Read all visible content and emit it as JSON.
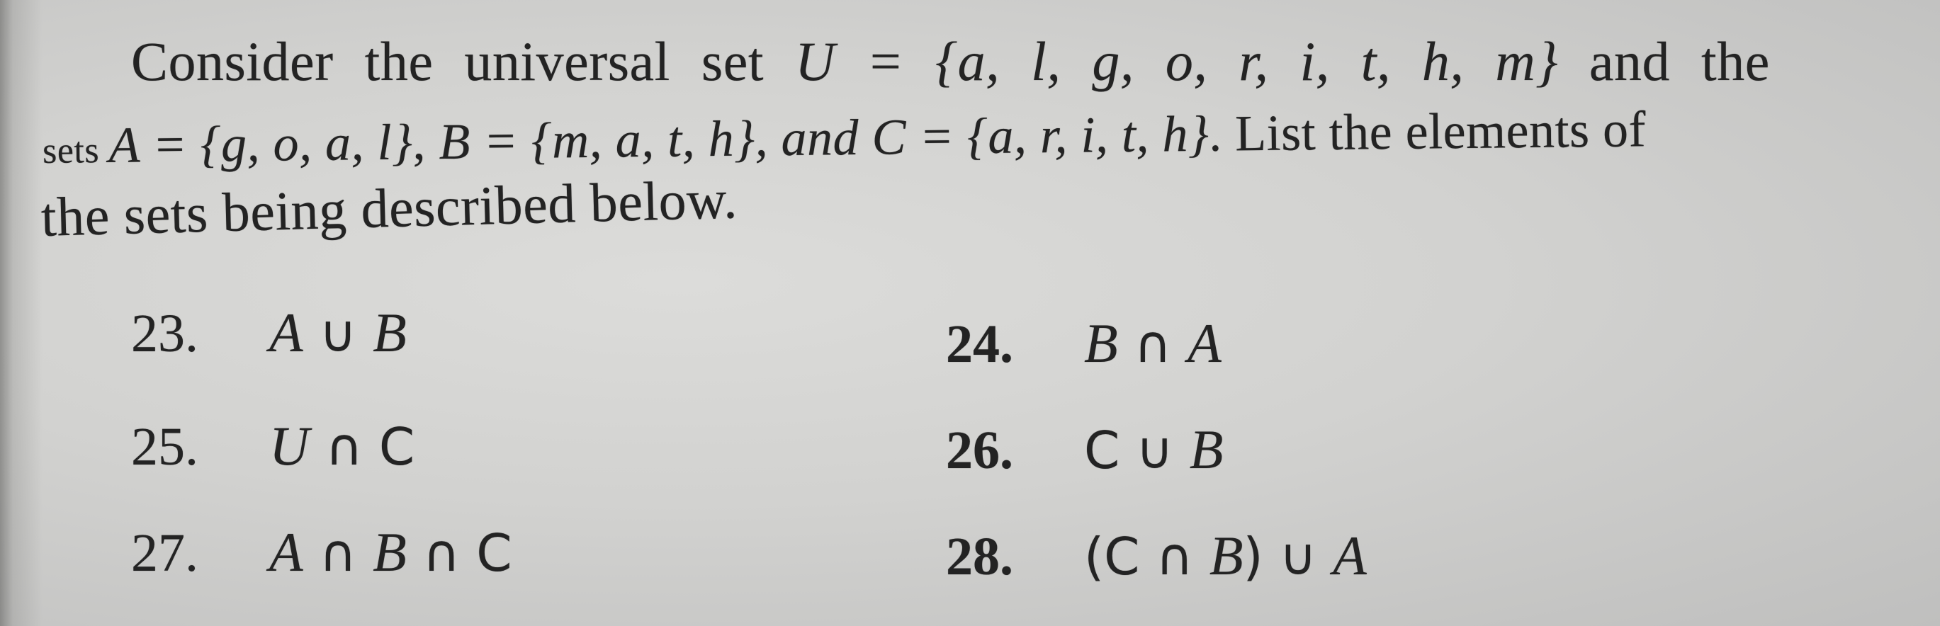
{
  "problem": {
    "intro": {
      "line1_text": "Consider the universal set ",
      "universal_set_name": "U",
      "universal_set_value": " = {a, l, g, o, r, i, t, h, m}",
      "line1_tail": " and the",
      "line2_prefix": "sets ",
      "set_A": "A = {g, o, a, l}",
      "sep1": ", ",
      "set_B": "B = {m, a, t, h}",
      "sep2": ", and ",
      "set_C": "C = {a, r, i, t, h}",
      "line2_tail": ". List the elements of",
      "line3_text": "the sets being described below."
    },
    "sets": {
      "U": [
        "a",
        "l",
        "g",
        "o",
        "r",
        "i",
        "t",
        "h",
        "m"
      ],
      "A": [
        "g",
        "o",
        "a",
        "l"
      ],
      "B": [
        "m",
        "a",
        "t",
        "h"
      ],
      "C": [
        "a",
        "r",
        "i",
        "t",
        "h"
      ]
    },
    "exercises": [
      {
        "number": "23.",
        "expression": "A ∪ B",
        "parts": [
          "A",
          " ∪ ",
          "B"
        ]
      },
      {
        "number": "24.",
        "expression": "B ∩ A",
        "parts": [
          "B",
          " ∩ ",
          "A"
        ]
      },
      {
        "number": "25.",
        "expression": "U ∩ C",
        "parts": [
          "U",
          " ∩ ",
          "C"
        ]
      },
      {
        "number": "26.",
        "expression": "C ∪ B",
        "parts": [
          "C",
          " ∪ ",
          "B"
        ]
      },
      {
        "number": "27.",
        "expression": "A ∩ B ∩ C",
        "parts": [
          "A",
          " ∩ ",
          "B",
          " ∩ ",
          "C"
        ]
      },
      {
        "number": "28.",
        "expression": "(C ∩ B) ∪ A",
        "parts": [
          "(C",
          " ∩ ",
          "B",
          ") ∪ ",
          "A"
        ]
      }
    ]
  }
}
